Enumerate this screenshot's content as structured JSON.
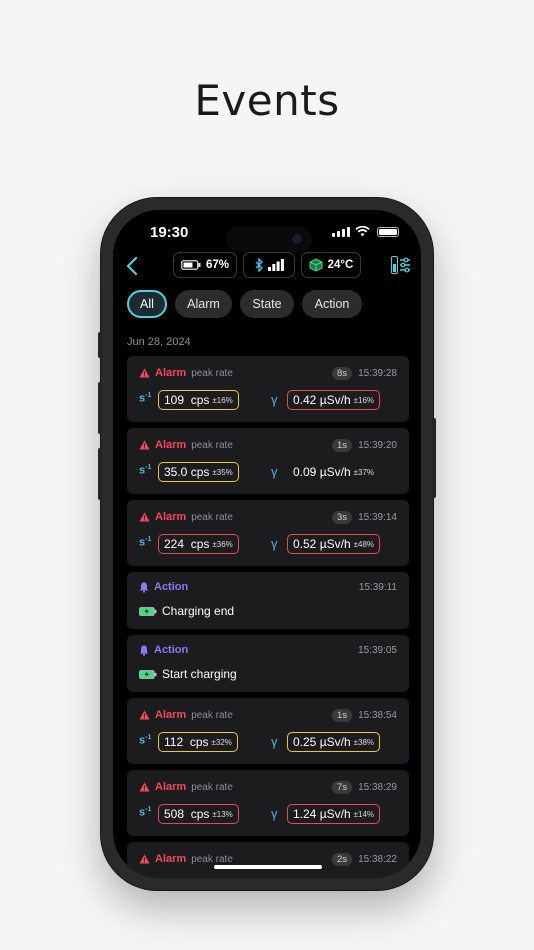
{
  "header": {
    "title": "Events"
  },
  "status_bar": {
    "time": "19:30"
  },
  "device": {
    "battery": "67%",
    "temperature": "24°C"
  },
  "colors": {
    "accent": "#4fd1e0",
    "alarm": "#f4475e",
    "action": "#8b7bf2",
    "warn_yellow": "#e8c93b",
    "warn_red": "#e64a5a"
  },
  "filters": [
    {
      "label": "All",
      "active": true
    },
    {
      "label": "Alarm",
      "active": false
    },
    {
      "label": "State",
      "active": false
    },
    {
      "label": "Action",
      "active": false
    }
  ],
  "date_label": "Jun 28, 2024",
  "events": [
    {
      "type": "Alarm",
      "sub": "peak rate",
      "duration": "8s",
      "time": "15:39:28",
      "cps": "109",
      "cps_unit": "cps",
      "cps_err": "±16%",
      "dose": "0.42 µSv/h",
      "dose_err": "±16%"
    },
    {
      "type": "Alarm",
      "sub": "peak rate",
      "duration": "1s",
      "time": "15:39:20",
      "cps": "35.0",
      "cps_unit": "cps",
      "cps_err": "±35%",
      "dose": "0.09 µSv/h",
      "dose_err": "±37%"
    },
    {
      "type": "Alarm",
      "sub": "peak rate",
      "duration": "3s",
      "time": "15:39:14",
      "cps": "224",
      "cps_unit": "cps",
      "cps_err": "±36%",
      "dose": "0.52 µSv/h",
      "dose_err": "±48%"
    },
    {
      "type": "Action",
      "time": "15:39:11",
      "text": "Charging end"
    },
    {
      "type": "Action",
      "time": "15:39:05",
      "text": "Start charging"
    },
    {
      "type": "Alarm",
      "sub": "peak rate",
      "duration": "1s",
      "time": "15:38:54",
      "cps": "112",
      "cps_unit": "cps",
      "cps_err": "±32%",
      "dose": "0.25 µSv/h",
      "dose_err": "±38%"
    },
    {
      "type": "Alarm",
      "sub": "peak rate",
      "duration": "7s",
      "time": "15:38:29",
      "cps": "508",
      "cps_unit": "cps",
      "cps_err": "±13%",
      "dose": "1.24 µSv/h",
      "dose_err": "±14%"
    },
    {
      "type": "Alarm",
      "sub": "peak rate",
      "duration": "2s",
      "time": "15:38:22"
    }
  ]
}
